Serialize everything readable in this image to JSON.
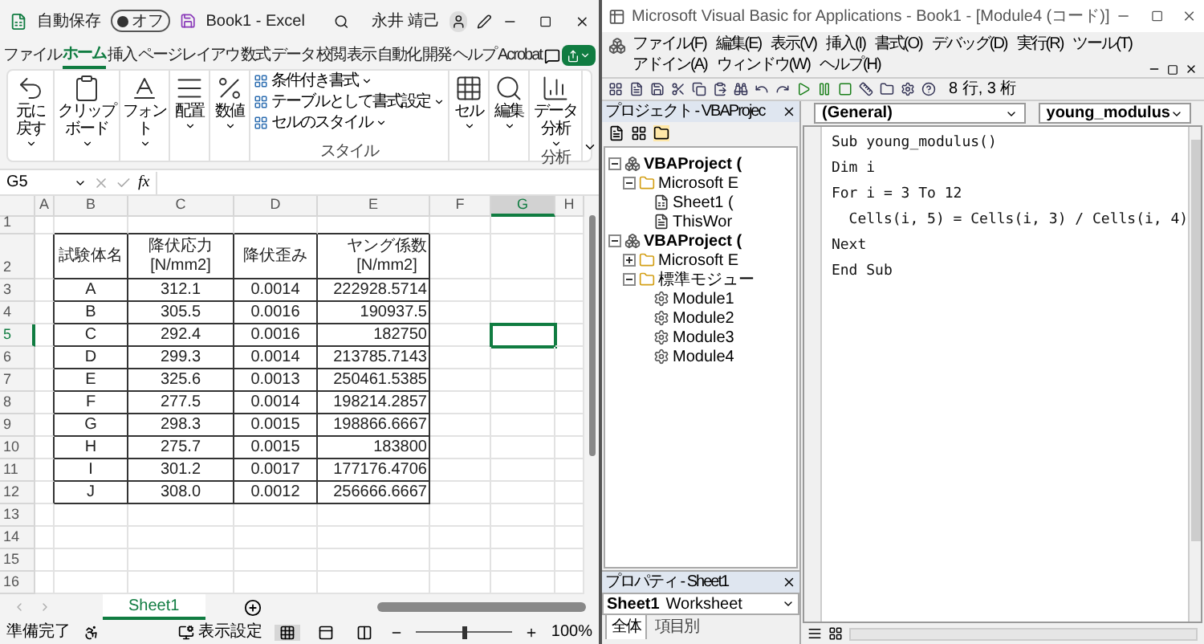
{
  "excel": {
    "title_bar": {
      "autosave_label": "自動保存",
      "autosave": {
        "on": false,
        "label": "オフ"
      },
      "document_title": "Book1 - Excel",
      "user_name": "永井 靖己"
    },
    "ribbon_tabs": [
      {
        "label": "ファイル",
        "selected": false
      },
      {
        "label": "ホーム",
        "selected": true
      },
      {
        "label": "挿入",
        "selected": false
      },
      {
        "label": "ページレイアウ",
        "selected": false
      },
      {
        "label": "数式",
        "selected": false
      },
      {
        "label": "データ",
        "selected": false
      },
      {
        "label": "校閲",
        "selected": false
      },
      {
        "label": "表示",
        "selected": false
      },
      {
        "label": "自動化",
        "selected": false
      },
      {
        "label": "開発",
        "selected": false
      },
      {
        "label": "ヘルプ",
        "selected": false
      },
      {
        "label": "Acrobat",
        "selected": false
      }
    ],
    "ribbon_groups": [
      {
        "kind": "button",
        "label": "元に戻す"
      },
      {
        "kind": "button",
        "label": "クリップボード"
      },
      {
        "kind": "button",
        "label": "フォント"
      },
      {
        "kind": "button",
        "label": "配置"
      },
      {
        "kind": "button",
        "label": "数値"
      },
      {
        "kind": "list",
        "items": [
          "条件付き書式",
          "テーブルとして書式設定",
          "セルのスタイル"
        ],
        "group_label": "スタイル"
      },
      {
        "kind": "button",
        "label": "セル"
      },
      {
        "kind": "button",
        "label": "編集"
      },
      {
        "kind": "button",
        "label": "データ分析",
        "group_label": "分析"
      }
    ],
    "name_box": "G5",
    "function_button": "fx",
    "column_headers": [
      {
        "label": "A",
        "selected": false
      },
      {
        "label": "B",
        "selected": false
      },
      {
        "label": "C",
        "selected": false
      },
      {
        "label": "D",
        "selected": false
      },
      {
        "label": "E",
        "selected": false
      },
      {
        "label": "F",
        "selected": false
      },
      {
        "label": "G",
        "selected": true
      },
      {
        "label": "H",
        "selected": false
      }
    ],
    "row_headers": [
      {
        "label": "1",
        "selected": false
      },
      {
        "label": "2",
        "selected": false
      },
      {
        "label": "3",
        "selected": false
      },
      {
        "label": "4",
        "selected": false
      },
      {
        "label": "5",
        "selected": true
      },
      {
        "label": "6",
        "selected": false
      },
      {
        "label": "7",
        "selected": false
      },
      {
        "label": "8",
        "selected": false
      },
      {
        "label": "9",
        "selected": false
      },
      {
        "label": "10",
        "selected": false
      },
      {
        "label": "11",
        "selected": false
      },
      {
        "label": "12",
        "selected": false
      },
      {
        "label": "13",
        "selected": false
      },
      {
        "label": "14",
        "selected": false
      },
      {
        "label": "15",
        "selected": false
      },
      {
        "label": "16",
        "selected": false
      }
    ],
    "data_table": {
      "header": [
        "試験体名",
        "降伏応力\n[N/mm2]",
        "降伏歪み",
        "ヤング係数\n[N/mm2]"
      ],
      "rows": [
        [
          "A",
          "312.1",
          "0.0014",
          "222928.5714"
        ],
        [
          "B",
          "305.5",
          "0.0016",
          "190937.5"
        ],
        [
          "C",
          "292.4",
          "0.0016",
          "182750"
        ],
        [
          "D",
          "299.3",
          "0.0014",
          "213785.7143"
        ],
        [
          "E",
          "325.6",
          "0.0013",
          "250461.5385"
        ],
        [
          "F",
          "277.5",
          "0.0014",
          "198214.2857"
        ],
        [
          "G",
          "298.3",
          "0.0015",
          "198866.6667"
        ],
        [
          "H",
          "275.7",
          "0.0015",
          "183800"
        ],
        [
          "I",
          "301.2",
          "0.0017",
          "177176.4706"
        ],
        [
          "J",
          "308.0",
          "0.0012",
          "256666.6667"
        ]
      ]
    },
    "sheet_tabs": [
      {
        "label": "Sheet1",
        "selected": true
      }
    ],
    "status_bar": {
      "status": "準備完了",
      "display_settings": "表示設定",
      "views": [
        {
          "selected": true
        },
        {
          "selected": false
        },
        {
          "selected": false
        }
      ],
      "zoom": {
        "level": 0.5,
        "reading": "100%"
      }
    }
  },
  "vba": {
    "title": "Microsoft Visual Basic for Applications - Book1 - [Module4 (コード)]",
    "menu": [
      "ファイル(F)",
      "編集(E)",
      "表示(V)",
      "挿入(I)",
      "書式(O)",
      "デバッグ(D)",
      "実行(R)",
      "ツール(T)",
      "アドイン(A)",
      "ウィンドウ(W)",
      "ヘルプ(H)"
    ],
    "cursor_position": "8 行, 3 桁",
    "project_pane": {
      "title": "プロジェクト - VBAProjec",
      "tree": [
        {
          "label": "VBAProject (",
          "kind": "project",
          "expanded": true,
          "children": [
            {
              "label": "Microsoft E",
              "kind": "folder",
              "expanded": true,
              "children": [
                {
                  "label": "Sheet1 (",
                  "kind": "sheet"
                },
                {
                  "label": "ThisWor",
                  "kind": "workbook"
                }
              ]
            }
          ]
        },
        {
          "label": "VBAProject (",
          "kind": "project",
          "expanded": true,
          "children": [
            {
              "label": "Microsoft E",
              "kind": "folder",
              "expanded": false
            },
            {
              "label": "標準モジュー",
              "kind": "folder",
              "expanded": true,
              "children": [
                {
                  "label": "Module1",
                  "kind": "module"
                },
                {
                  "label": "Module2",
                  "kind": "module"
                },
                {
                  "label": "Module3",
                  "kind": "module"
                },
                {
                  "label": "Module4",
                  "kind": "module"
                }
              ]
            }
          ]
        }
      ]
    },
    "properties_pane": {
      "title": "プロパティ - Sheet1",
      "object": "Sheet1",
      "object_type": "Worksheet",
      "tabs": [
        {
          "label": "全体",
          "selected": true
        },
        {
          "label": "項目別",
          "selected": false
        }
      ]
    },
    "code_pane": {
      "object": "(General)",
      "procedure": "young_modulus",
      "lines": [
        "Sub young_modulus()",
        "Dim i",
        "For i = 3 To 12",
        "  Cells(i, 5) = Cells(i, 3) / Cells(i, 4)",
        "Next",
        "End Sub"
      ]
    }
  }
}
